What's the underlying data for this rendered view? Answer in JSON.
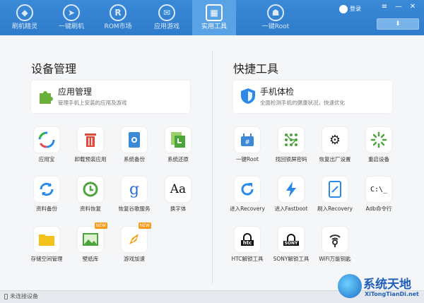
{
  "tabs": [
    {
      "label": "刷机精灵",
      "icon": "shield-icon"
    },
    {
      "label": "一键刷机",
      "icon": "cursor-icon"
    },
    {
      "label": "ROM市场",
      "icon": "rom-icon"
    },
    {
      "label": "应用游戏",
      "icon": "mail-icon"
    },
    {
      "label": "实用工具",
      "icon": "grid-icon"
    },
    {
      "label": "一键Root",
      "icon": "robot-icon"
    }
  ],
  "header": {
    "login": "登录"
  },
  "left": {
    "title": "设备管理",
    "card": {
      "title": "应用管理",
      "desc": "管理手机上安装的应用及游戏"
    },
    "tools": [
      {
        "label": "应用宝",
        "icon": "yingyongbao-icon"
      },
      {
        "label": "卸载预装应用",
        "icon": "trash-icon"
      },
      {
        "label": "系统备份",
        "icon": "system-backup-icon"
      },
      {
        "label": "系统还原",
        "icon": "system-restore-icon"
      },
      {
        "label": "资料备份",
        "icon": "sync-icon"
      },
      {
        "label": "资料恢复",
        "icon": "clock-icon"
      },
      {
        "label": "恢复谷歌服务",
        "icon": "google-icon"
      },
      {
        "label": "换字体",
        "icon": "font-icon"
      },
      {
        "label": "存储空间管理",
        "icon": "folder-icon"
      },
      {
        "label": "壁纸库",
        "icon": "picture-icon",
        "badge": "NEW"
      },
      {
        "label": "游戏加速",
        "icon": "rocket-icon",
        "badge": "NEW"
      }
    ]
  },
  "right": {
    "title": "快捷工具",
    "card": {
      "title": "手机体检",
      "desc": "全面检测手机的健康状况，快速优化"
    },
    "tools": [
      {
        "label": "一键Root",
        "icon": "root-icon"
      },
      {
        "label": "找回锁屏密码",
        "icon": "pattern-icon"
      },
      {
        "label": "恢复出厂设置",
        "icon": "gears-icon"
      },
      {
        "label": "重启设备",
        "icon": "loading-icon"
      },
      {
        "label": "进入Recovery",
        "icon": "refresh-icon"
      },
      {
        "label": "进入Fastboot",
        "icon": "lightning-icon"
      },
      {
        "label": "刷入Recovery",
        "icon": "tablet-icon"
      },
      {
        "label": "Adb命令行",
        "icon": "terminal-icon",
        "glyph": "C:\\_"
      },
      {
        "label": "HTC解锁工具",
        "icon": "htc-lock-icon",
        "glyph": "htc"
      },
      {
        "label": "SONY解锁工具",
        "icon": "sony-lock-icon",
        "glyph": "SONY"
      },
      {
        "label": "WiFi万能钥匙",
        "icon": "wifi-key-icon"
      }
    ]
  },
  "status": {
    "text": "未连接设备"
  },
  "watermark": {
    "title": "系统天地",
    "url": "XiTongTianDi.net"
  }
}
